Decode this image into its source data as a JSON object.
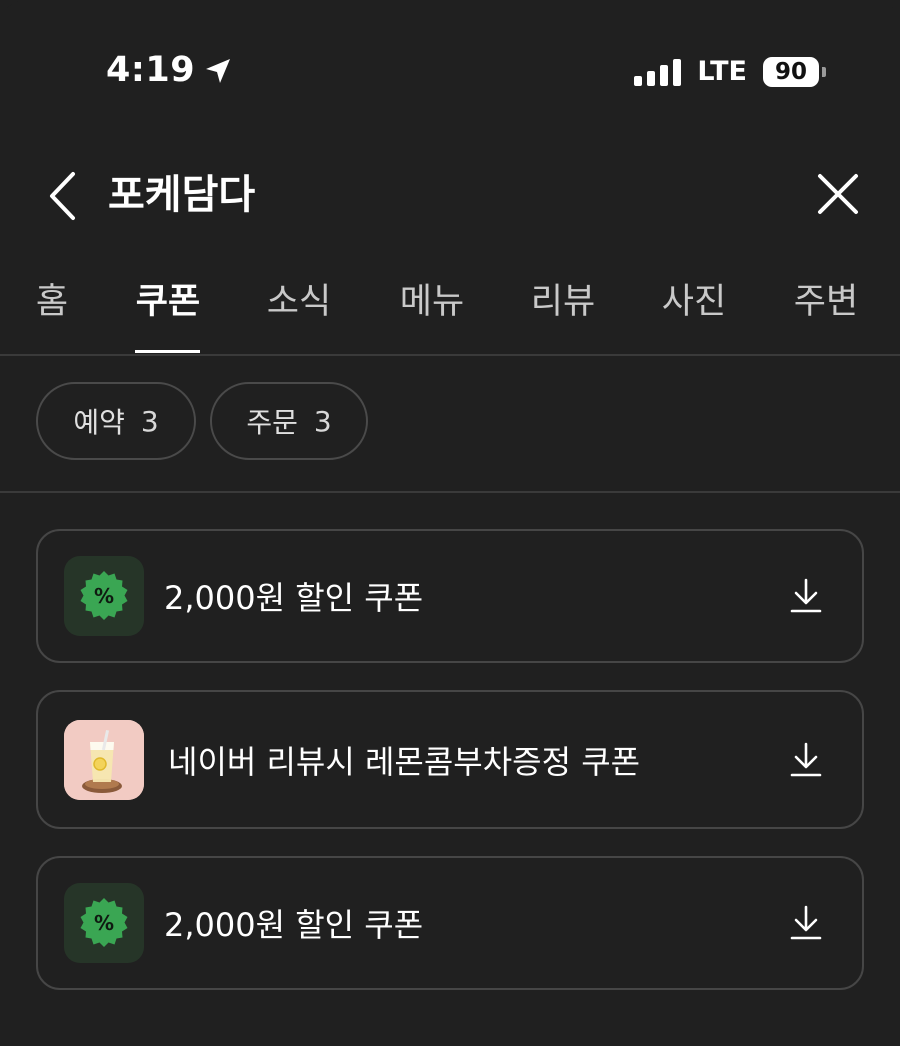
{
  "status_bar": {
    "time": "4:19",
    "network": "LTE",
    "battery": "90"
  },
  "header": {
    "title": "포케담다"
  },
  "tabs": [
    {
      "label": "홈",
      "active": false
    },
    {
      "label": "쿠폰",
      "active": true
    },
    {
      "label": "소식",
      "active": false
    },
    {
      "label": "메뉴",
      "active": false
    },
    {
      "label": "리뷰",
      "active": false
    },
    {
      "label": "사진",
      "active": false
    },
    {
      "label": "주변",
      "active": false
    }
  ],
  "filters": [
    {
      "label": "예약",
      "count": "3"
    },
    {
      "label": "주문",
      "count": "3"
    }
  ],
  "coupons": [
    {
      "title": "2,000원 할인 쿠폰",
      "icon": "percent-badge-icon"
    },
    {
      "title": "네이버 리뷰시 레몬콤부차증정 쿠폰",
      "icon": "lemon-drink-thumbnail"
    },
    {
      "title": "2,000원 할인 쿠폰",
      "icon": "percent-badge-icon"
    }
  ],
  "colors": {
    "background": "#202020",
    "badge_green": "#3aa653",
    "badge_bg": "#263528",
    "border": "#464646"
  }
}
